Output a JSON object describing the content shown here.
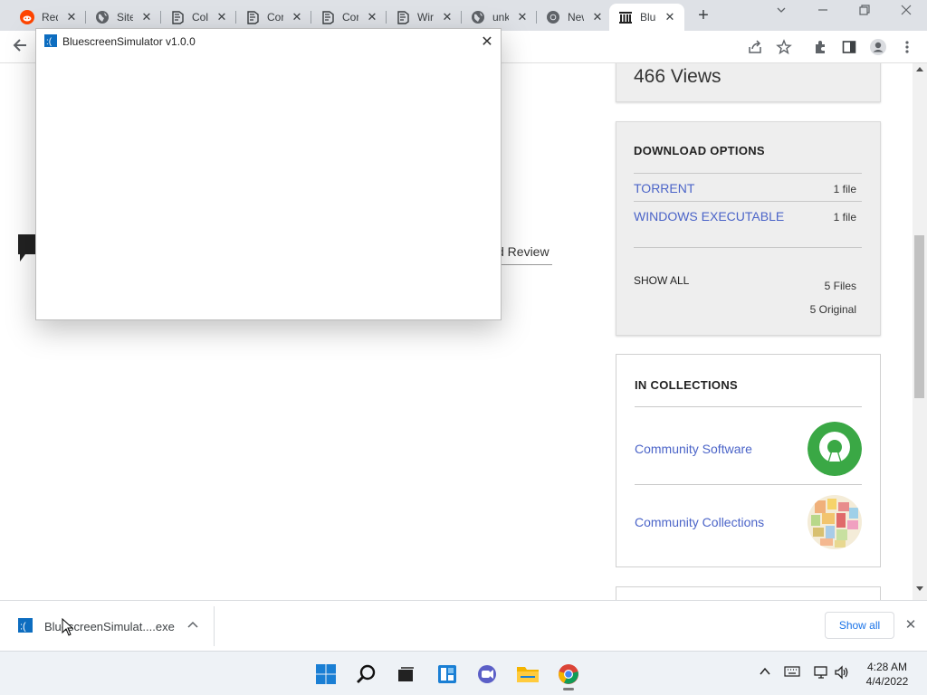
{
  "tabs": [
    {
      "title": "Red",
      "icon": "reddit-icon"
    },
    {
      "title": "Site",
      "icon": "globe-icon"
    },
    {
      "title": "Coll",
      "icon": "archive-icon"
    },
    {
      "title": "Cor",
      "icon": "archive-icon"
    },
    {
      "title": "Cor",
      "icon": "archive-icon"
    },
    {
      "title": "Wir",
      "icon": "archive-icon"
    },
    {
      "title": "unk",
      "icon": "globe-icon"
    },
    {
      "title": "New",
      "icon": "chrome-icon"
    },
    {
      "title": "Blue",
      "icon": "archive-building-icon",
      "active": true
    }
  ],
  "tab_close_glyph": "✕",
  "new_tab_glyph": "+",
  "page": {
    "views": "466 Views",
    "download_options": {
      "heading": "DOWNLOAD OPTIONS",
      "items": [
        {
          "label": "TORRENT",
          "count": "1 file"
        },
        {
          "label": "WINDOWS EXECUTABLE",
          "count": "1 file"
        }
      ],
      "show_all": "SHOW ALL",
      "files": "5 Files",
      "original": "5 Original"
    },
    "collections": {
      "heading": "IN COLLECTIONS",
      "items": [
        {
          "label": "Community Software",
          "icon": "open-source-keyhole-icon"
        },
        {
          "label": "Community Collections",
          "icon": "mosaic-icon"
        }
      ]
    },
    "review_fragment": "d Review"
  },
  "modal": {
    "title": "BluescreenSimulator v1.0.0",
    "close_glyph": "✕"
  },
  "download_shelf": {
    "filename": "BluescreenSimulat....exe",
    "show_all": "Show all",
    "chevron": "^",
    "close": "✕"
  },
  "taskbar": {
    "time": "4:28 AM",
    "date": "4/4/2022",
    "apps": [
      "windows-start-icon",
      "search-icon",
      "task-view-icon",
      "widgets-icon",
      "chat-icon",
      "file-explorer-icon",
      "chrome-icon"
    ]
  },
  "colors": {
    "link": "#4b64c8",
    "tabstrip": "#dee1e6",
    "card": "#eeeeee",
    "accent": "#1a73e8"
  }
}
